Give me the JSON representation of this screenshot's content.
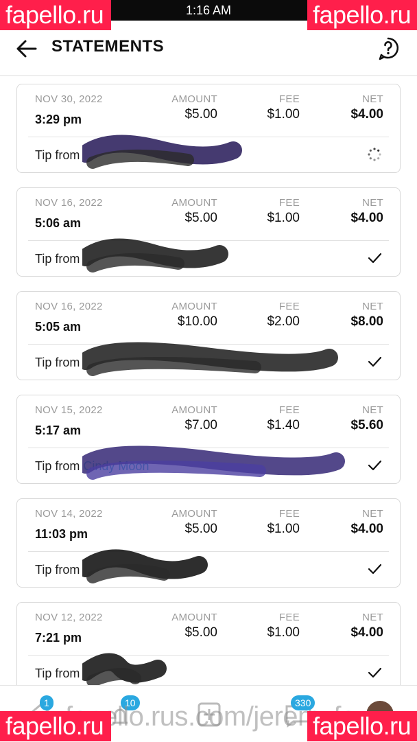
{
  "status_bar": {
    "time": "1:16 AM"
  },
  "watermark": {
    "text": "fapello.ru",
    "url_text": "fapello.rus.com/jeremyfa"
  },
  "header": {
    "title": "STATEMENTS"
  },
  "columns": {
    "amount": "AMOUNT",
    "fee": "FEE",
    "net": "NET"
  },
  "statements": [
    {
      "date": "NOV 30, 2022",
      "time": "3:29 pm",
      "amount": "$5.00",
      "fee": "$1.00",
      "net": "$4.00",
      "tip_prefix": "Tip from",
      "tipper": "",
      "status": "pending"
    },
    {
      "date": "NOV 16, 2022",
      "time": "5:06 am",
      "amount": "$5.00",
      "fee": "$1.00",
      "net": "$4.00",
      "tip_prefix": "Tip from",
      "tipper": "",
      "status": "complete"
    },
    {
      "date": "NOV 16, 2022",
      "time": "5:05 am",
      "amount": "$10.00",
      "fee": "$2.00",
      "net": "$8.00",
      "tip_prefix": "Tip from",
      "tipper": "",
      "status": "complete"
    },
    {
      "date": "NOV 15, 2022",
      "time": "5:17 am",
      "amount": "$7.00",
      "fee": "$1.40",
      "net": "$5.60",
      "tip_prefix": "Tip from",
      "tipper": "Cindy Moon",
      "status": "complete"
    },
    {
      "date": "NOV 14, 2022",
      "time": "11:03 pm",
      "amount": "$5.00",
      "fee": "$1.00",
      "net": "$4.00",
      "tip_prefix": "Tip from",
      "tipper": "",
      "status": "complete"
    },
    {
      "date": "NOV 12, 2022",
      "time": "7:21 pm",
      "amount": "$5.00",
      "fee": "$1.00",
      "net": "$4.00",
      "tip_prefix": "Tip from",
      "tipper": "",
      "status": "complete"
    }
  ],
  "bottom_nav": {
    "items": [
      {
        "icon": "home-icon",
        "badge": "1"
      },
      {
        "icon": "notifications-icon",
        "badge": "10"
      },
      {
        "icon": "add-post-icon",
        "badge": ""
      },
      {
        "icon": "messages-icon",
        "badge": "330"
      },
      {
        "icon": "avatar",
        "badge": ""
      }
    ]
  },
  "colors": {
    "accent": "#2aa8e0",
    "watermark": "#ff1f4b",
    "link": "#2aa8c8"
  }
}
